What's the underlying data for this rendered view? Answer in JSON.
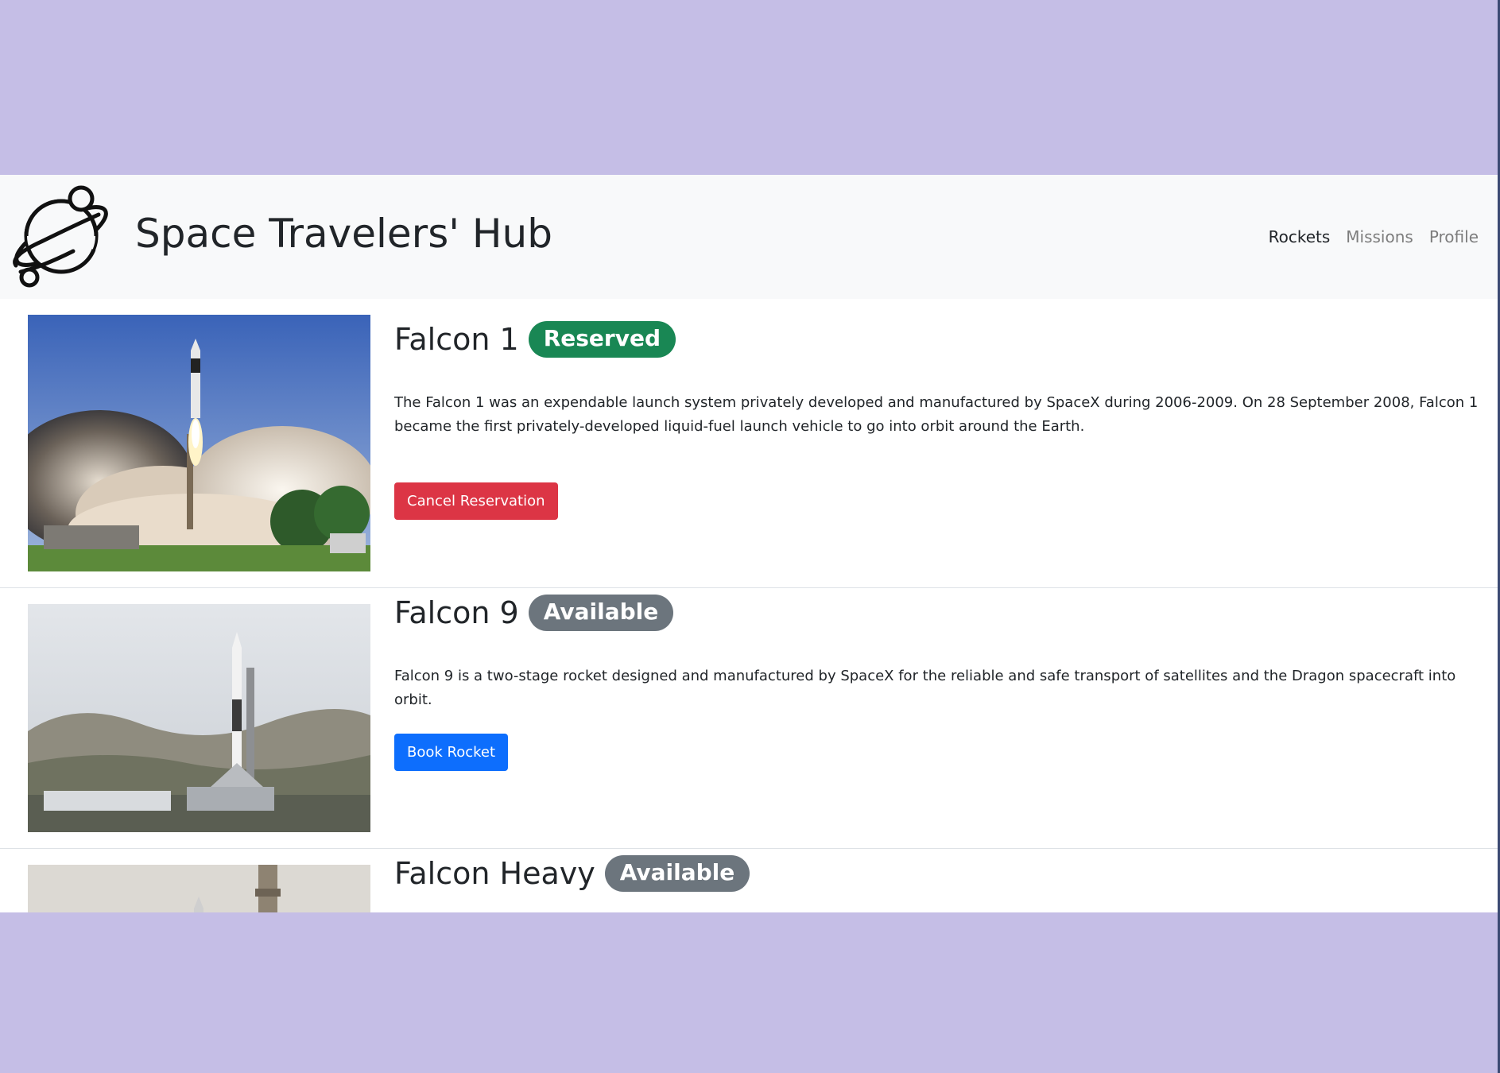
{
  "brand": {
    "title": "Space Travelers' Hub",
    "logo_icon": "planet-icon"
  },
  "nav": {
    "items": [
      {
        "label": "Rockets",
        "active": true
      },
      {
        "label": "Missions",
        "active": false
      },
      {
        "label": "Profile",
        "active": false
      }
    ]
  },
  "rockets": [
    {
      "name": "Falcon 1",
      "badge": "Reserved",
      "description": "The Falcon 1 was an expendable launch system privately developed and manufactured by SpaceX during 2006-2009. On 28 September 2008, Falcon 1 became the first privately-developed liquid-fuel launch vehicle to go into orbit around the Earth.",
      "button": "Cancel Reservation"
    },
    {
      "name": "Falcon 9",
      "badge": "Available",
      "description": "Falcon 9 is a two-stage rocket designed and manufactured by SpaceX for the reliable and safe transport of satellites and the Dragon spacecraft into orbit.",
      "button": "Book Rocket"
    },
    {
      "name": "Falcon Heavy",
      "badge": "Available"
    }
  ],
  "colors": {
    "backdrop": "#c5bee6",
    "navbar": "#f8f9fa",
    "reserved_badge": "#198754",
    "available_badge": "#6c757d",
    "cancel_button": "#dc3545",
    "book_button": "#0d6efd"
  }
}
